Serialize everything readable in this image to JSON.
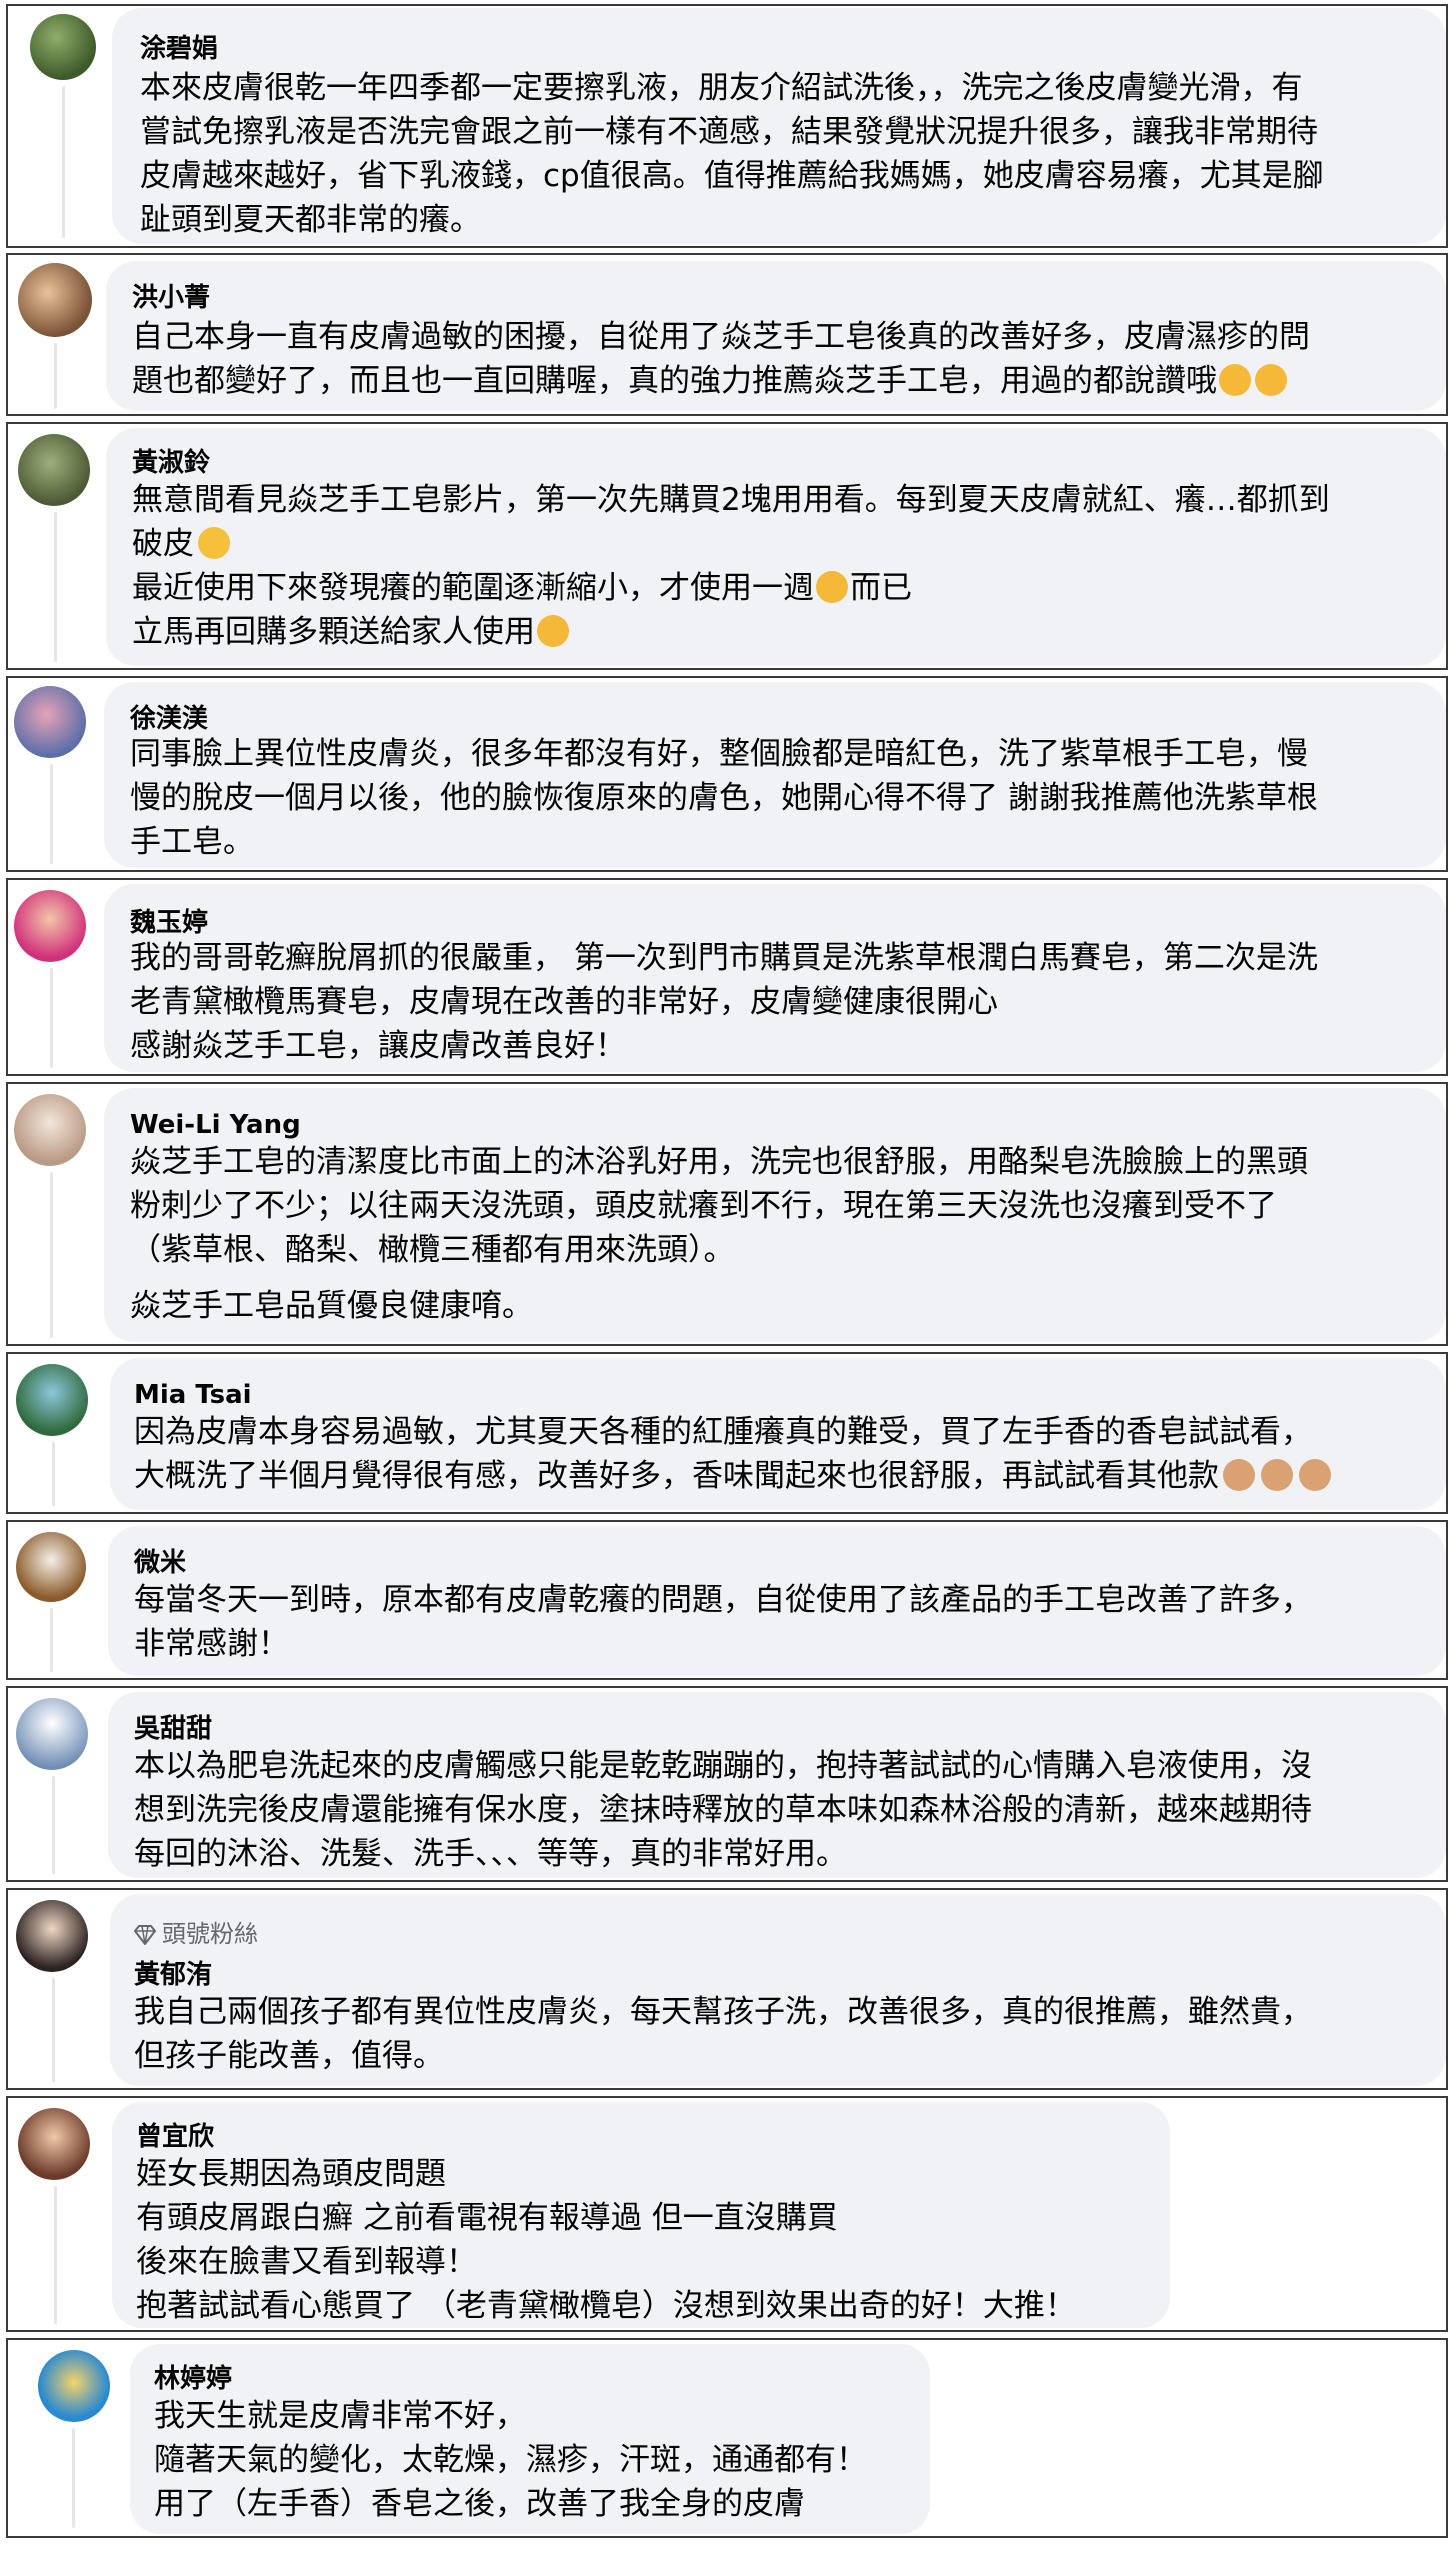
{
  "colors": {
    "bubble": "#f0f2f5",
    "card_border": "#3a3a3a",
    "text": "#050505",
    "muted": "#65676b"
  },
  "comments": [
    {
      "name": "涂碧娟",
      "lines": [
        "本來皮膚很乾一年四季都一定要擦乳液，朋友介紹試洗後，，洗完之後皮膚變光滑，有",
        "嘗試免擦乳液是否洗完會跟之前一樣有不適感，結果發覺狀況提升很多，讓我非常期待",
        "皮膚越來越好，省下乳液錢，cp值很高。值得推薦給我媽媽，她皮膚容易癢，尤其是腳",
        "趾頭到夏天都非常的癢。"
      ]
    },
    {
      "name": "洪小菁",
      "lines": [
        "自己本身一直有皮膚過敏的困擾，自從用了焱芝手工皂後真的改善好多，皮膚濕疹的問",
        "題也都變好了，而且也一直回購喔，真的強力推薦焱芝手工皂，用過的都說讚哦"
      ],
      "trailing_emoji": [
        "thumbs-up",
        "thumbs-up"
      ]
    },
    {
      "name": "黃淑鈴",
      "lines": [
        "無意間看見焱芝手工皂影片，第一次先購買2塊用用看。每到夏天皮膚就紅、癢…都抓到",
        "破皮",
        "最近使用下來發現癢的範圍逐漸縮小，才使用一週",
        "立馬再回購多顆送給家人使用"
      ],
      "line_tail_1": "",
      "line_mid_2_after": "而已"
    },
    {
      "name": "徐渼渼",
      "lines": [
        "同事臉上異位性皮膚炎，很多年都沒有好，整個臉都是暗紅色，洗了紫草根手工皂，慢",
        "慢的脫皮一個月以後，他的臉恢復原來的膚色，她開心得不得了 謝謝我推薦他洗紫草根",
        "手工皂。"
      ]
    },
    {
      "name": "魏玉婷",
      "lines": [
        "我的哥哥乾癬脫屑抓的很嚴重， 第一次到門市購買是洗紫草根潤白馬賽皂，第二次是洗",
        "老青黛橄欖馬賽皂，皮膚現在改善的非常好，皮膚變健康很開心",
        "感謝焱芝手工皂，讓皮膚改善良好！"
      ]
    },
    {
      "name": "Wei-Li Yang",
      "lines": [
        "焱芝手工皂的清潔度比市面上的沐浴乳好用，洗完也很舒服，用酪梨皂洗臉臉上的黑頭",
        "粉刺少了不少；以往兩天沒洗頭，頭皮就癢到不行，現在第三天沒洗也沒癢到受不了",
        "（紫草根、酪梨、橄欖三種都有用來洗頭）。",
        "焱芝手工皂品質優良健康唷。"
      ]
    },
    {
      "name": "Mia Tsai",
      "lines": [
        "因為皮膚本身容易過敏，尤其夏天各種的紅腫癢真的難受，買了左手香的香皂試試看，",
        "大概洗了半個月覺得很有感，改善好多，香味聞起來也很舒服，再試試看其他款"
      ],
      "trailing_emoji": [
        "thumbs-up",
        "thumbs-up",
        "thumbs-up"
      ]
    },
    {
      "name": "微米",
      "lines": [
        "每當冬天一到時，原本都有皮膚乾癢的問題，自從使用了該產品的手工皂改善了許多，",
        "非常感謝！"
      ]
    },
    {
      "name": "吳甜甜",
      "lines": [
        "本以為肥皂洗起來的皮膚觸感只能是乾乾蹦蹦的，抱持著試試的心情購入皂液使用，沒",
        "想到洗完後皮膚還能擁有保水度，塗抹時釋放的草本味如森林浴般的清新，越來越期待",
        "每回的沐浴、洗髮、洗手、、、等等，真的非常好用。"
      ]
    },
    {
      "badge": "頭號粉絲",
      "name": "黃郁洧",
      "lines": [
        "我自己兩個孩子都有異位性皮膚炎，每天幫孩子洗，改善很多，真的很推薦，雖然貴，",
        "但孩子能改善，值得。"
      ]
    },
    {
      "name": "曾宜欣",
      "lines": [
        "姪女長期因為頭皮問題",
        "有頭皮屑跟白癬 之前看電視有報導過 但一直沒購買",
        "後來在臉書又看到報導！",
        "抱著試試看心態買了 （老青黛橄欖皂）沒想到效果出奇的好！大推！"
      ]
    },
    {
      "name": "林婷婷",
      "lines": [
        "我天生就是皮膚非常不好，",
        "隨著天氣的變化，太乾燥，濕疹，汗斑，通通都有！",
        "用了（左手香）香皂之後，改善了我全身的皮膚"
      ]
    }
  ]
}
